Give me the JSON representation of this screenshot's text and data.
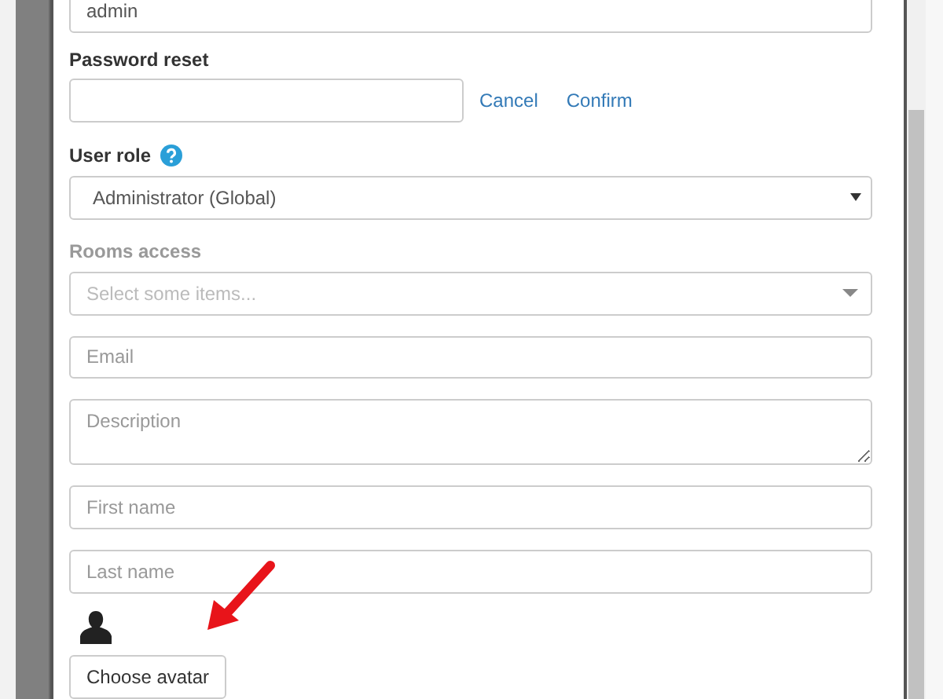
{
  "username": {
    "value": "admin"
  },
  "password_reset": {
    "label": "Password reset",
    "actions": [
      "Cancel",
      "Confirm"
    ]
  },
  "user_role": {
    "label": "User role",
    "value": "Administrator (Global)"
  },
  "rooms_access": {
    "label": "Rooms access",
    "disabled": true,
    "placeholder": "Select some items..."
  },
  "fields": [
    {
      "kind": "input",
      "placeholder": "Email"
    },
    {
      "kind": "textarea",
      "placeholder": "Description"
    },
    {
      "kind": "input",
      "placeholder": "First name"
    },
    {
      "kind": "input",
      "placeholder": "Last name"
    }
  ],
  "avatar": {
    "button": "Choose avatar"
  }
}
